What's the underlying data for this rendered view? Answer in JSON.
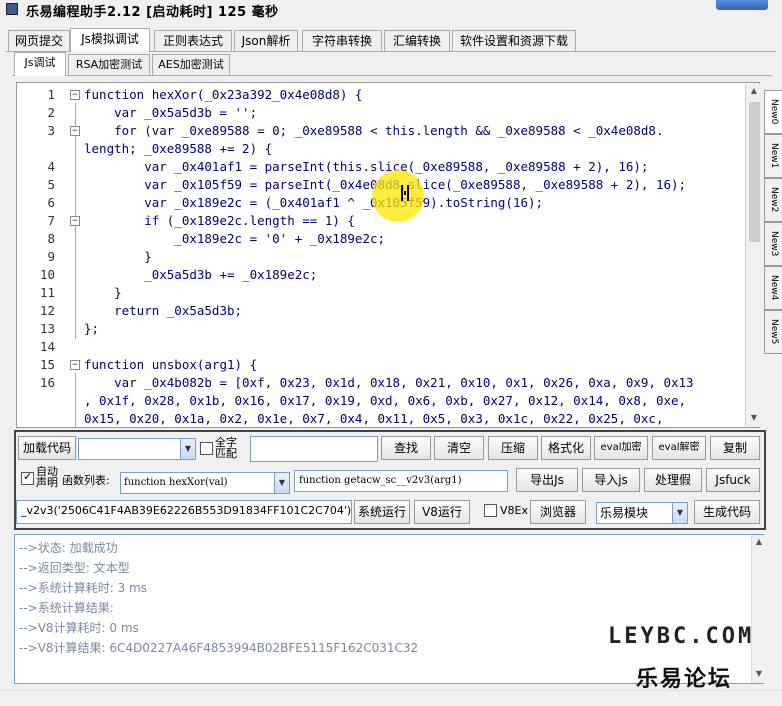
{
  "window": {
    "title": "乐易编程助手2.12 [启动耗时] 125 毫秒"
  },
  "main_tabs": [
    {
      "label": "网页提交"
    },
    {
      "label": "Js模拟调试"
    },
    {
      "label": "正则表达式"
    },
    {
      "label": "Json解析"
    },
    {
      "label": "字符串转换"
    },
    {
      "label": "汇编转换"
    },
    {
      "label": "软件设置和资源下载"
    }
  ],
  "sub_tabs": [
    {
      "label": "Js调试"
    },
    {
      "label": "RSA加密测试"
    },
    {
      "label": "AES加密测试"
    }
  ],
  "side_tabs": [
    {
      "label": "New0"
    },
    {
      "label": "New1"
    },
    {
      "label": "New2"
    },
    {
      "label": "New3"
    },
    {
      "label": "New4"
    },
    {
      "label": "New5"
    }
  ],
  "code_lines": [
    {
      "n": "1",
      "text": "function hexXor(_0x23a392_0x4e08d8) {"
    },
    {
      "n": "2",
      "text": "    var _0x5a5d3b = '';"
    },
    {
      "n": "3",
      "text": "    for (var _0xe89588 = 0; _0xe89588 < this.length && _0xe89588 < _0x4e08d8."
    },
    {
      "n": "",
      "text": "length; _0xe89588 += 2) {"
    },
    {
      "n": "4",
      "text": "        var _0x401af1 = parseInt(this.slice(_0xe89588, _0xe89588 + 2), 16);"
    },
    {
      "n": "5",
      "text": "        var _0x105f59 = parseInt(_0x4e08d8.slice(_0xe89588, _0xe89588 + 2), 16);"
    },
    {
      "n": "6",
      "text": "        var _0x189e2c = (_0x401af1 ^ _0x105f59).toString(16);"
    },
    {
      "n": "7",
      "text": "        if (_0x189e2c.length == 1) {"
    },
    {
      "n": "8",
      "text": "            _0x189e2c = '0' + _0x189e2c;"
    },
    {
      "n": "9",
      "text": "        }"
    },
    {
      "n": "10",
      "text": "        _0x5a5d3b += _0x189e2c;"
    },
    {
      "n": "11",
      "text": "    }"
    },
    {
      "n": "12",
      "text": "    return _0x5a5d3b;"
    },
    {
      "n": "13",
      "text": "};"
    },
    {
      "n": "14",
      "text": ""
    },
    {
      "n": "15",
      "text": "function unsbox(arg1) {"
    },
    {
      "n": "16",
      "text": "    var _0x4b082b = [0xf, 0x23, 0x1d, 0x18, 0x21, 0x10, 0x1, 0x26, 0xa, 0x9, 0x13"
    },
    {
      "n": "",
      "text": ", 0x1f, 0x28, 0x1b, 0x16, 0x17, 0x19, 0xd, 0x6, 0xb, 0x27, 0x12, 0x14, 0x8, 0xe,"
    },
    {
      "n": "",
      "text": "0x15, 0x20, 0x1a, 0x2, 0x1e, 0x7, 0x4, 0x11, 0x5, 0x3, 0x1c, 0x22, 0x25, 0xc,"
    }
  ],
  "toolbar": {
    "load_code": "加载代码",
    "full_match": "全字匹配",
    "find": "查找",
    "clear": "清空",
    "compress": "压缩",
    "format": "格式化",
    "eval_encrypt": "eval加密",
    "eval_decrypt": "eval解密",
    "copy": "复制",
    "auto_declare": "自动声明",
    "func_list_label": "函数列表:",
    "func_list_value": "function hexXor(val)",
    "func_call_field": "function getacw_sc__v2v3(arg1)",
    "export_js": "导出Js",
    "import_js": "导入js",
    "handle_fake": "处理假",
    "jsfuck": "Jsfuck",
    "expression_field": "_v2v3('2506C41F4AB39E62226B553D91834FF101C2C704')",
    "system_run": "系统运行",
    "v8_run": "V8运行",
    "v8ex": "V8Ex",
    "browser": "浏览器",
    "module_value": "乐易模块",
    "generate_code": "生成代码"
  },
  "output_lines": [
    "-->状态: 加载成功",
    "-->返回类型: 文本型",
    "-->系统计算耗时: 3 ms",
    "-->系统计算结果:",
    "-->V8计算耗时: 0 ms",
    "-->V8计算结果: 6C4D0227A46F4853994B02BFE5115F162C031C32"
  ],
  "watermark": {
    "site": "LEYBC.COM",
    "forum": "乐易论坛"
  }
}
